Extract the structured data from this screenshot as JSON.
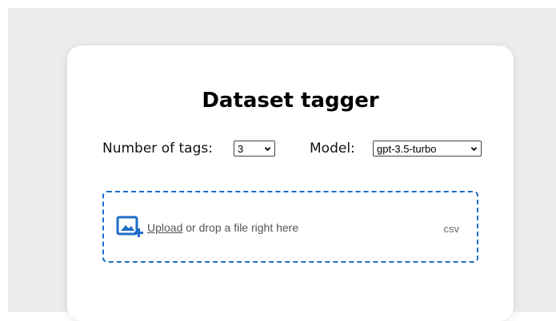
{
  "app": {
    "title": "Dataset tagger"
  },
  "controls": {
    "tags_label": "Number of tags:",
    "tags_value": "3",
    "model_label": "Model:",
    "model_value": "gpt-3.5-turbo"
  },
  "dropzone": {
    "link_text": "Upload",
    "text": " or drop a file right here",
    "accepted_types": "csv"
  },
  "icons": {
    "upload": "image-add-icon",
    "dropdown": "chevron-down-icon"
  },
  "colors": {
    "accent": "#1f6ec7",
    "background": "#ececec",
    "card": "#ffffff"
  }
}
